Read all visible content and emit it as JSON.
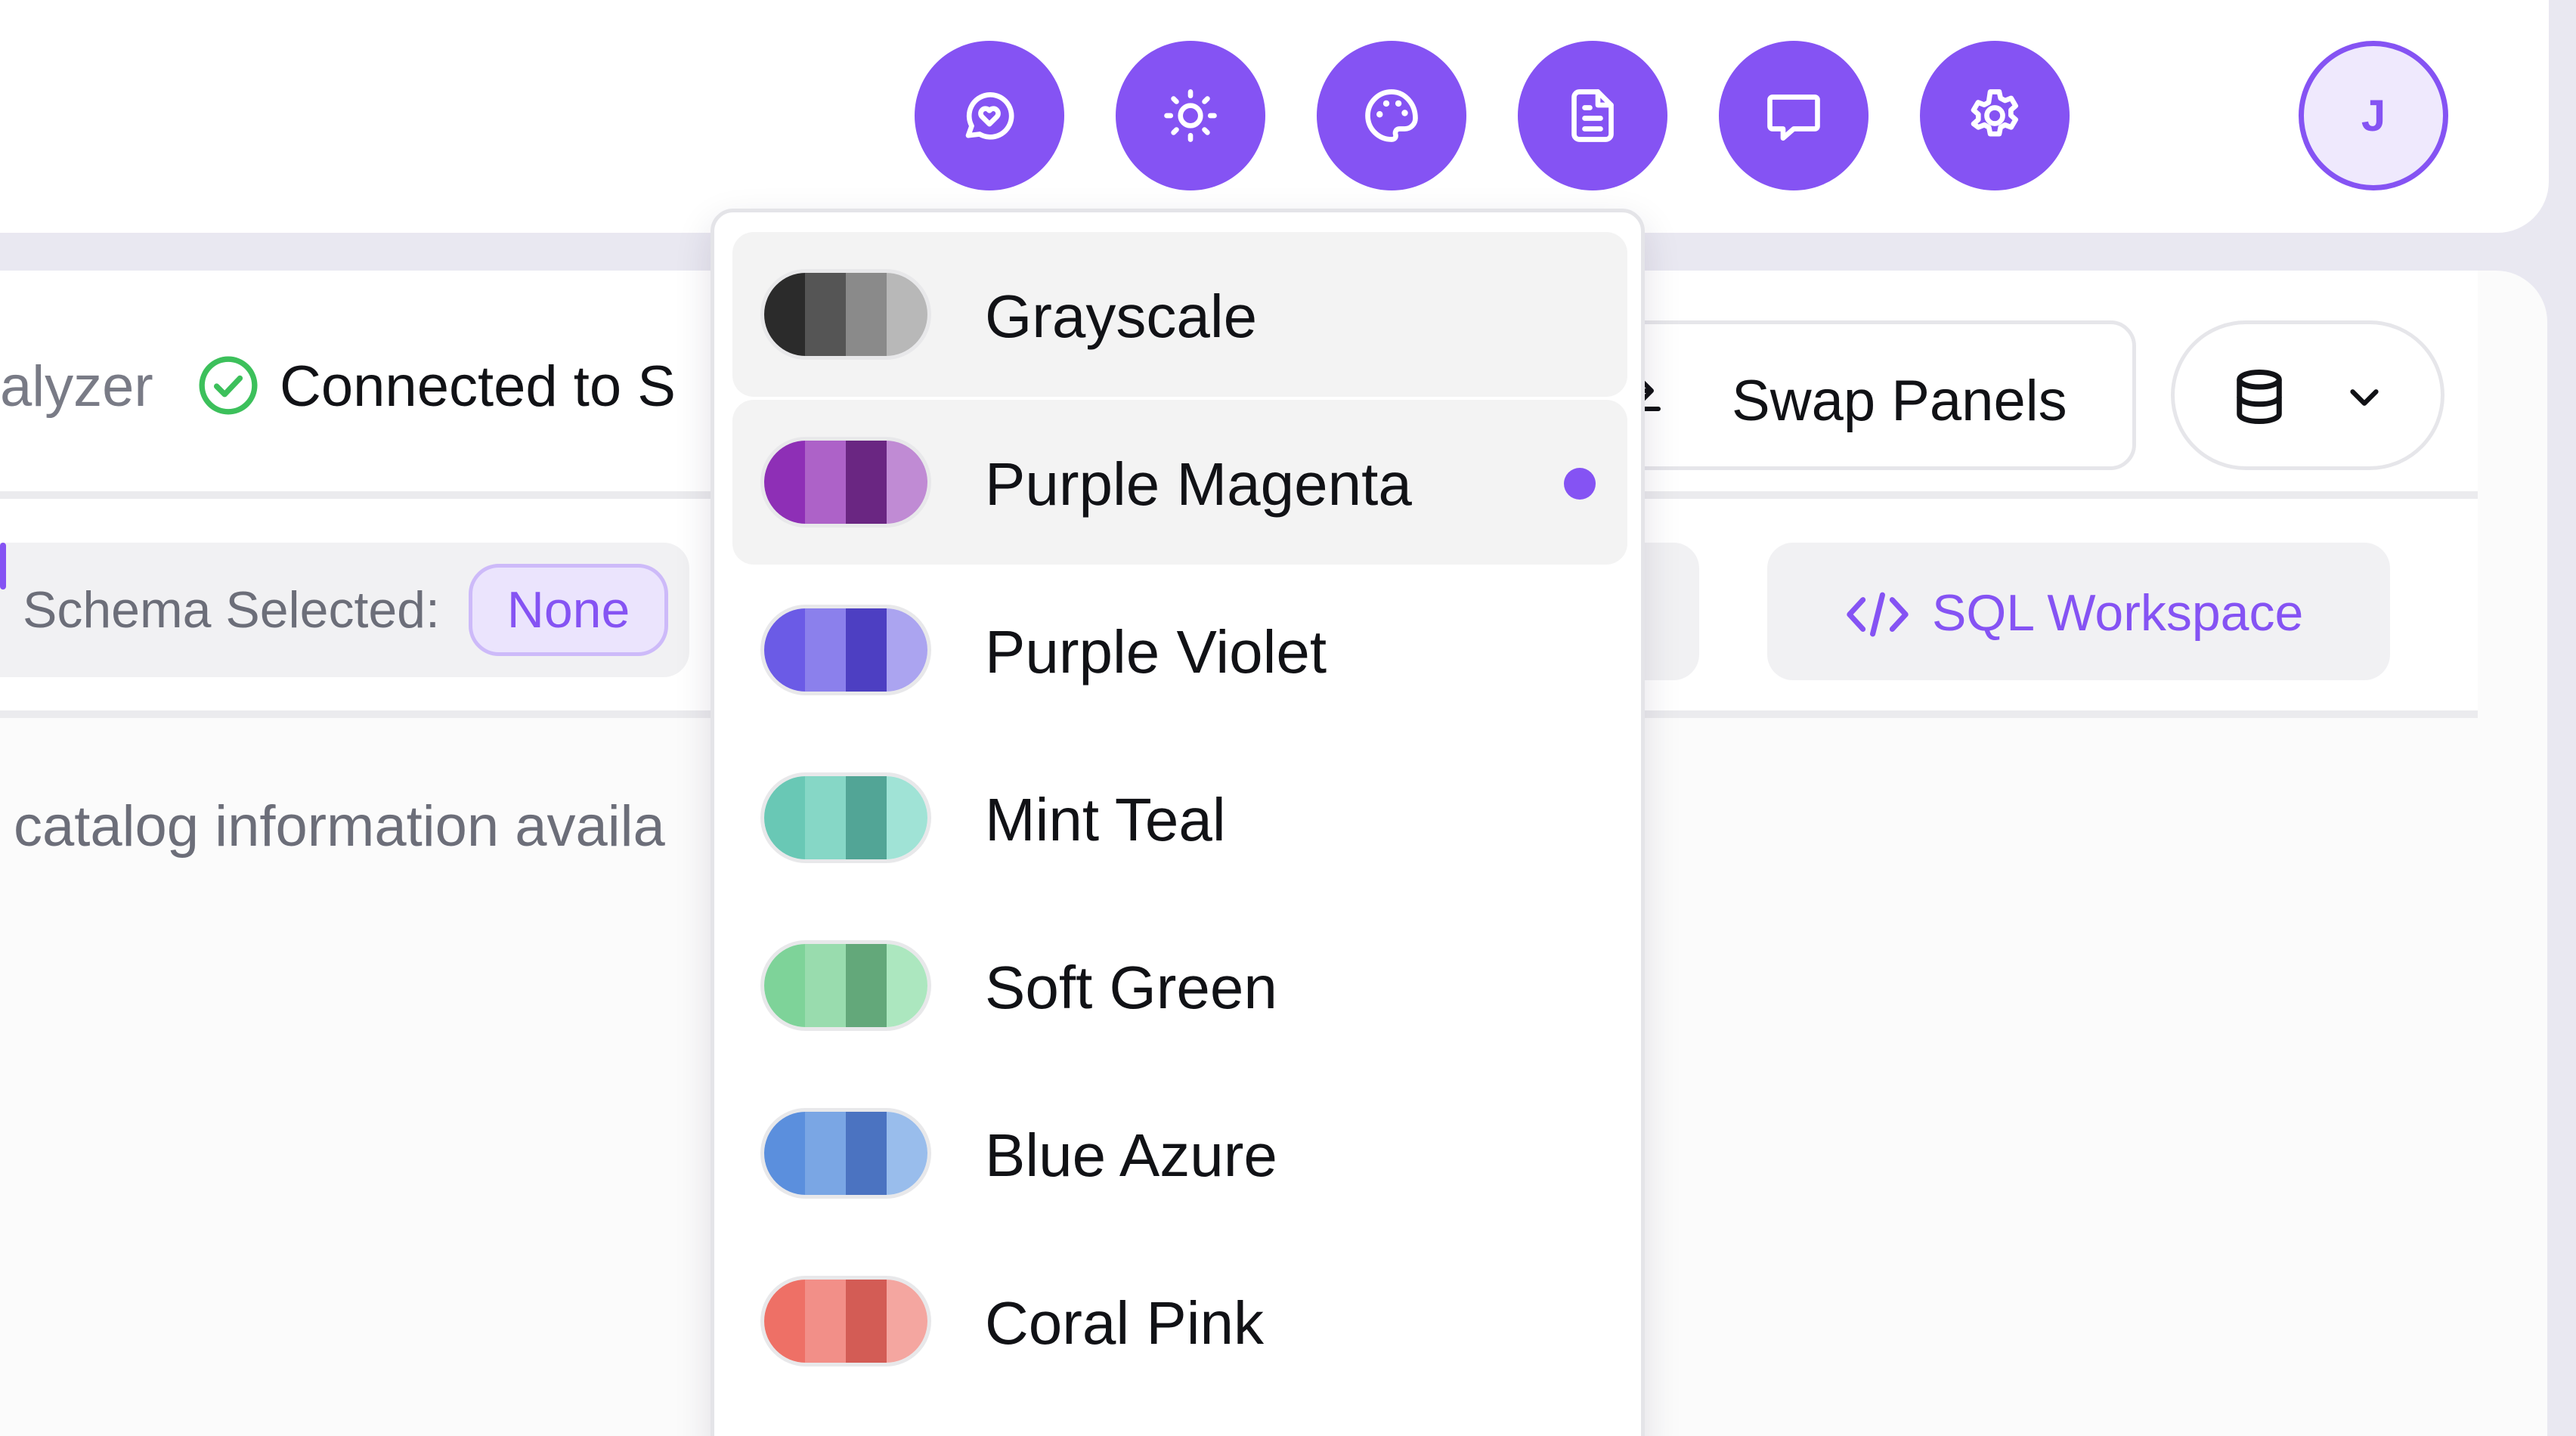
{
  "colors": {
    "accent": "#8553f3",
    "success": "#3cc05b"
  },
  "header": {
    "actions": [
      {
        "icon": "chat-heart-icon"
      },
      {
        "icon": "sun-icon"
      },
      {
        "icon": "palette-icon"
      },
      {
        "icon": "document-icon"
      },
      {
        "icon": "message-icon"
      },
      {
        "icon": "gear-icon"
      }
    ],
    "avatar_initial": "J"
  },
  "toolbar": {
    "app_name_fragment": "alyzer",
    "connection_status": "Connected to S",
    "swap_label": "Swap Panels",
    "database_icon": "database-icon"
  },
  "schema": {
    "label": "Schema Selected:",
    "value": "None"
  },
  "tabs": {
    "sql_label": "SQL Workspace"
  },
  "content": {
    "empty_message": "catalog information availa"
  },
  "theme_menu": {
    "items": [
      {
        "label": "Grayscale",
        "colors": [
          "#2b2b2b",
          "#555555",
          "#8a8a8a",
          "#b8b8b8"
        ],
        "hovered": true,
        "selected": false
      },
      {
        "label": "Purple Magenta",
        "colors": [
          "#8e2fb6",
          "#ad62c8",
          "#6a2682",
          "#c08bd4"
        ],
        "hovered": false,
        "selected": true
      },
      {
        "label": "Purple Violet",
        "colors": [
          "#6b5be6",
          "#8b80ec",
          "#4d3fc2",
          "#aba4f0"
        ],
        "hovered": false,
        "selected": false
      },
      {
        "label": "Mint Teal",
        "colors": [
          "#69c8b5",
          "#86d7c6",
          "#52a596",
          "#a0e3d6"
        ],
        "hovered": false,
        "selected": false
      },
      {
        "label": "Soft Green",
        "colors": [
          "#7ed399",
          "#99dcae",
          "#63a87a",
          "#ace7bf"
        ],
        "hovered": false,
        "selected": false
      },
      {
        "label": "Blue Azure",
        "colors": [
          "#5b8fdd",
          "#7aa6e4",
          "#4b73c1",
          "#99bdec"
        ],
        "hovered": false,
        "selected": false
      },
      {
        "label": "Coral Pink",
        "colors": [
          "#ee7066",
          "#f28f88",
          "#d35c55",
          "#f4a6a0"
        ],
        "hovered": false,
        "selected": false
      }
    ]
  }
}
